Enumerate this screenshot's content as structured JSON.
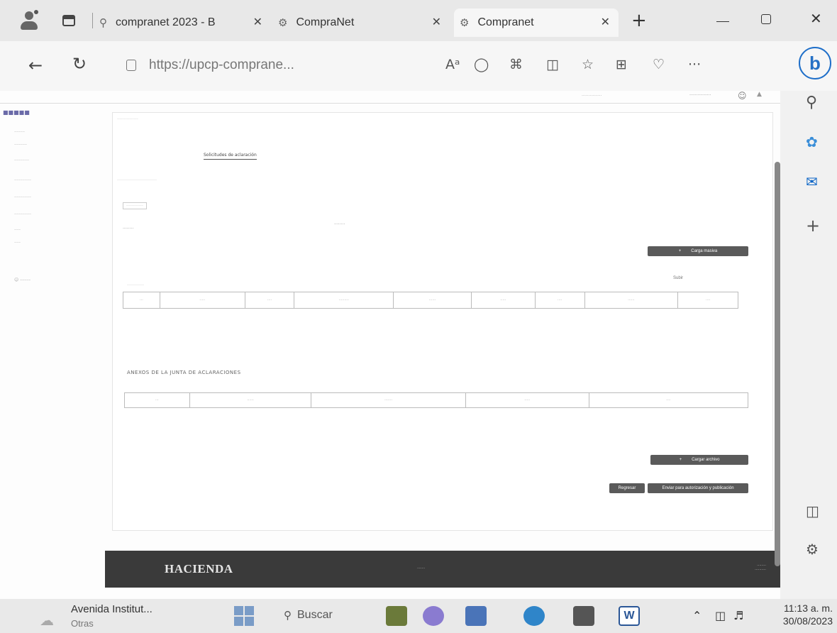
{
  "browser": {
    "tabs": [
      {
        "label": "compranet 2023 - B",
        "icon": "search-icon"
      },
      {
        "label": "CompraNet",
        "icon": "gear-icon"
      },
      {
        "label": "Compranet",
        "icon": "gear-icon"
      }
    ],
    "new_tab_glyph": "+",
    "url": "https://upcp-comprane...",
    "toolbar_icons": [
      "read-aloud-icon",
      "zoom-icon",
      "favorite-star-icon",
      "tracking-icon",
      "extensions-icon",
      "split-screen-icon",
      "favorites-icon",
      "collections-icon",
      "browser-essentials-icon",
      "more-icon",
      "bing-copilot-icon"
    ],
    "read_aloud_glyph": "Aᵃ",
    "more_glyph": "···",
    "bing_glyph": "b",
    "sidebar_icons": [
      "search-icon",
      "copilot-icon",
      "outlook-icon",
      "add-icon",
      "sidebar-toggle-icon",
      "settings-icon"
    ],
    "add_glyph": "+"
  },
  "page": {
    "section_title": "ANEXOS DE LA JUNTA DE ACLARACIONES",
    "tab_active": "Solicitudes de aclaración",
    "buttons": {
      "load_file": "Carga masiva",
      "load_icon_glyph": "+",
      "upload_label": "Subir",
      "attach": "Cargar archivo",
      "attach_icon_glyph": "+",
      "back": "Regresar",
      "send": "Enviar para autorización y publicación"
    },
    "footer": {
      "brand": "HACIENDA"
    }
  },
  "taskbar": {
    "weather_title": "Avenida Institut...",
    "weather_sub": "Otras",
    "search_placeholder": "Buscar",
    "time": "11:13 a. m.",
    "date": "30/08/2023"
  },
  "colors": {
    "footer_bg": "#3a3a3a",
    "button_dark": "#5a5a5a",
    "bing_accent": "#1f6fc9"
  }
}
